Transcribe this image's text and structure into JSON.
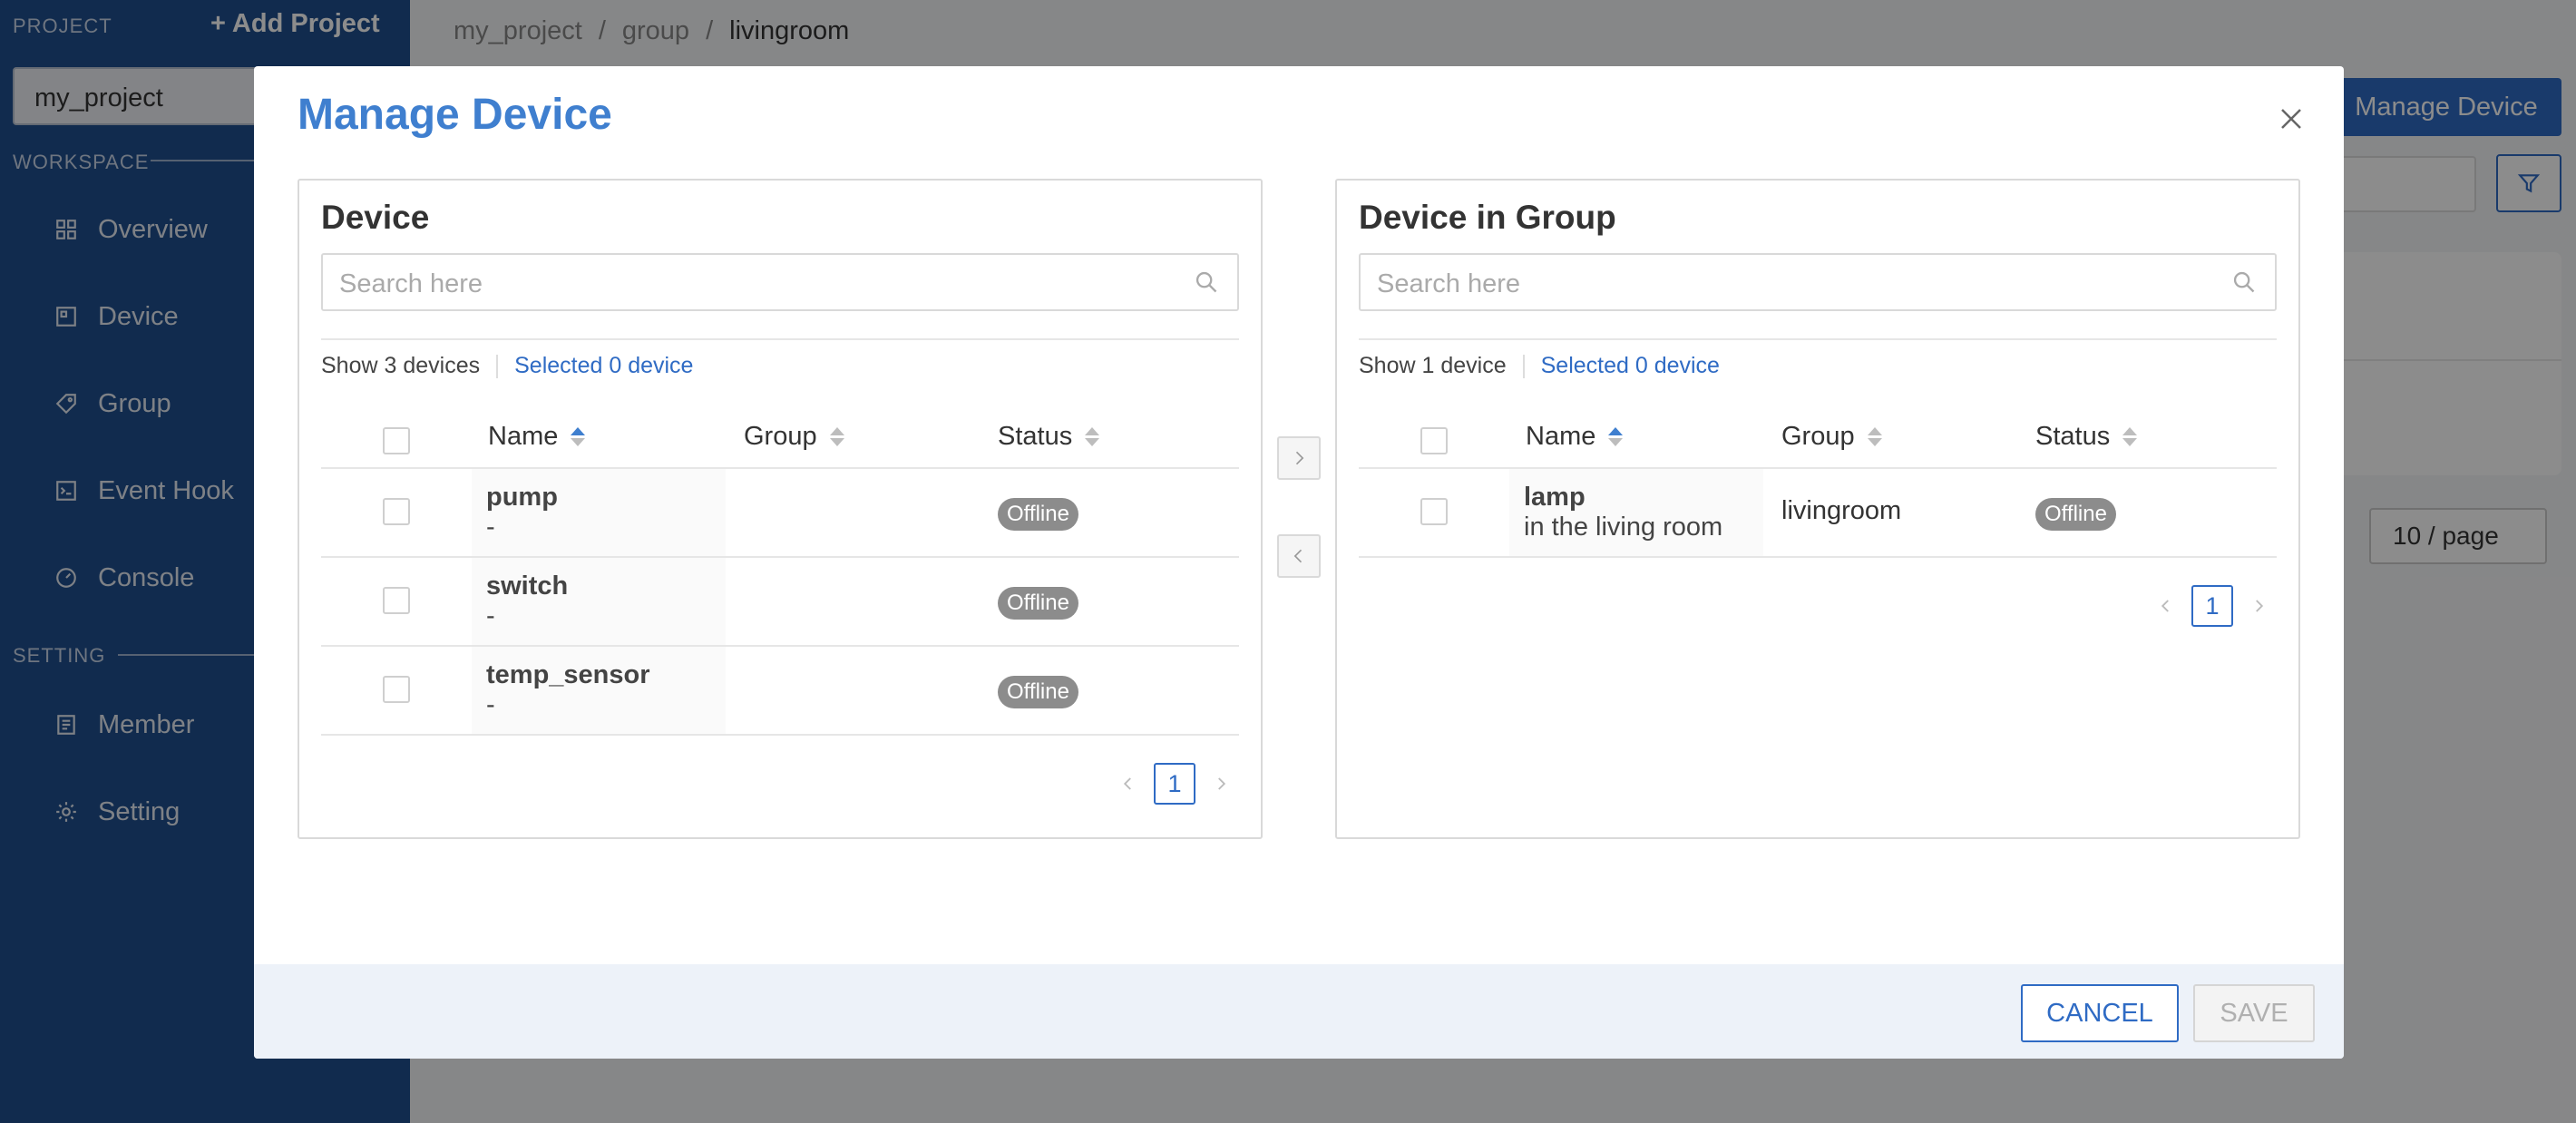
{
  "sidebar": {
    "project_label": "PROJECT",
    "add_project": "+ Add Project",
    "project_value": "my_project",
    "workspace_label": "WORKSPACE",
    "setting_label": "SETTING",
    "workspace_items": [
      {
        "label": "Overview",
        "icon": "overview-icon"
      },
      {
        "label": "Device",
        "icon": "device-icon"
      },
      {
        "label": "Group",
        "icon": "group-icon"
      },
      {
        "label": "Event Hook",
        "icon": "event-hook-icon"
      },
      {
        "label": "Console",
        "icon": "console-icon"
      }
    ],
    "setting_items": [
      {
        "label": "Member",
        "icon": "member-icon"
      },
      {
        "label": "Setting",
        "icon": "gear-icon"
      }
    ]
  },
  "breadcrumb": [
    "my_project",
    "group",
    "livingroom"
  ],
  "background": {
    "manage_device_button": "Manage Device",
    "page_size": "10 / page"
  },
  "modal": {
    "title": "Manage Device",
    "cancel_label": "CANCEL",
    "save_label": "SAVE",
    "left": {
      "title": "Device",
      "search_placeholder": "Search here",
      "count_text": "Show 3 devices",
      "selected_text": "Selected 0 device",
      "columns": [
        "Name",
        "Group",
        "Status"
      ],
      "rows": [
        {
          "name": "pump",
          "desc": "-",
          "group": "",
          "status": "Offline"
        },
        {
          "name": "switch",
          "desc": "-",
          "group": "",
          "status": "Offline"
        },
        {
          "name": "temp_sensor",
          "desc": "-",
          "group": "",
          "status": "Offline"
        }
      ],
      "page": "1"
    },
    "right": {
      "title": "Device in Group",
      "search_placeholder": "Search here",
      "count_text": "Show 1 device",
      "selected_text": "Selected 0 device",
      "columns": [
        "Name",
        "Group",
        "Status"
      ],
      "rows": [
        {
          "name": "lamp",
          "desc": "in the living room",
          "group": "livingroom",
          "status": "Offline"
        }
      ],
      "page": "1"
    }
  },
  "colors": {
    "sidebar_bg": "#1f4f8e",
    "accent": "#2f6bc4",
    "title": "#3f7fcf",
    "status_badge": "#8c8c8c"
  }
}
